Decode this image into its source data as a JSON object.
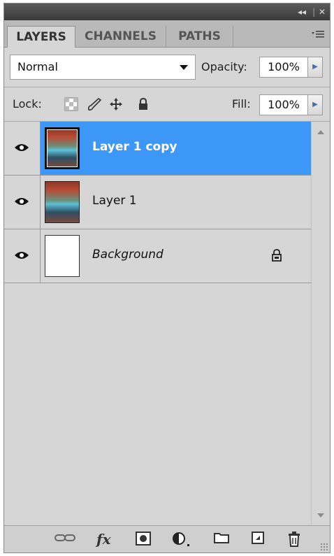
{
  "titlebar": {
    "collapse_glyph": "◂◂",
    "separator": "|",
    "close_glyph": "✕"
  },
  "tabs": [
    {
      "label": "LAYERS",
      "active": true
    },
    {
      "label": "CHANNELS",
      "active": false
    },
    {
      "label": "PATHS",
      "active": false
    }
  ],
  "panel_menu_icon": "panel-menu-icon",
  "blend_mode": {
    "value": "Normal"
  },
  "opacity": {
    "label": "Opacity:",
    "value": "100%"
  },
  "lock": {
    "label": "Lock:",
    "icons": [
      "lock-transparent-pixels-icon",
      "lock-image-pixels-icon",
      "lock-position-icon",
      "lock-all-icon"
    ]
  },
  "fill": {
    "label": "Fill:",
    "value": "100%"
  },
  "layers": [
    {
      "name": "Layer 1 copy",
      "visible": true,
      "selected": true,
      "thumbnail": "photo",
      "italic": false,
      "locked": false
    },
    {
      "name": "Layer 1",
      "visible": true,
      "selected": false,
      "thumbnail": "photo",
      "italic": false,
      "locked": false
    },
    {
      "name": "Background",
      "visible": true,
      "selected": false,
      "thumbnail": "white",
      "italic": true,
      "locked": true
    }
  ],
  "bottom_toolbar": {
    "icons": [
      "link-layers-icon",
      "fx-layer-style-icon",
      "add-mask-icon",
      "adjustment-layer-icon",
      "new-group-icon",
      "new-layer-icon",
      "delete-layer-icon"
    ],
    "fx_label": "fx"
  },
  "colors": {
    "selected_row": "#3d97f6",
    "panel_bg": "#d6d6d6",
    "titlebar": "#3a3a3a"
  }
}
